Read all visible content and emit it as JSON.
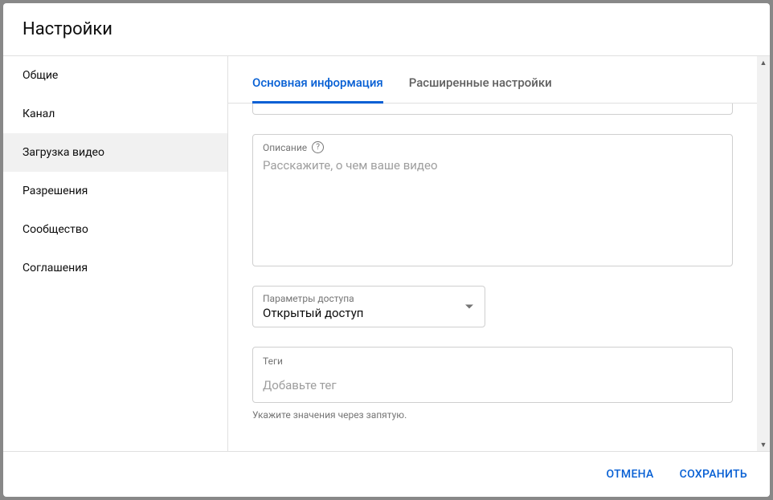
{
  "header": {
    "title": "Настройки"
  },
  "sidebar": {
    "items": [
      {
        "label": "Общие"
      },
      {
        "label": "Канал"
      },
      {
        "label": "Загрузка видео"
      },
      {
        "label": "Разрешения"
      },
      {
        "label": "Сообщество"
      },
      {
        "label": "Соглашения"
      }
    ],
    "selected_index": 2
  },
  "tabs": {
    "items": [
      {
        "label": "Основная информация"
      },
      {
        "label": "Расширенные настройки"
      }
    ],
    "active_index": 0
  },
  "form": {
    "description": {
      "label": "Описание",
      "placeholder": "Расскажите, о чем ваше видео",
      "value": ""
    },
    "visibility": {
      "label": "Параметры доступа",
      "value": "Открытый доступ"
    },
    "tags": {
      "label": "Теги",
      "placeholder": "Добавьте тег",
      "value": "",
      "helper": "Укажите значения через запятую."
    }
  },
  "footer": {
    "cancel": "ОТМЕНА",
    "save": "СОХРАНИТЬ"
  }
}
